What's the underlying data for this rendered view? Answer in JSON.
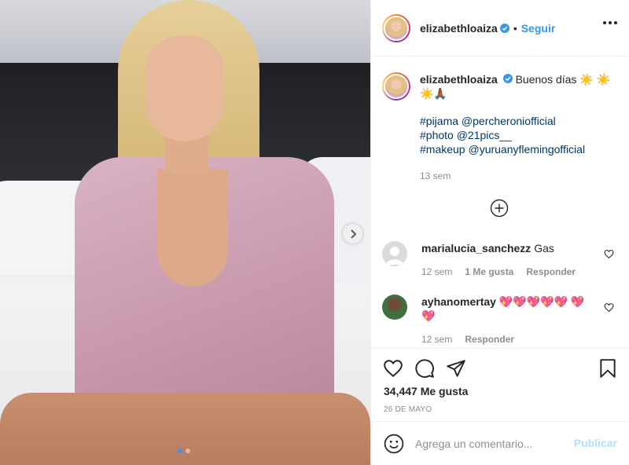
{
  "post": {
    "username": "elizabethloaiza",
    "follow_label": "Seguir",
    "bullet": "•",
    "verified_icon": "verified-badge-icon",
    "more_icon": "more-options-icon"
  },
  "caption": {
    "username": "elizabethloaiza",
    "text": "Buenos días ☀️ ☀️☀️🙏🏾",
    "hashtags": [
      "#pijama @percheroniofficial",
      "#photo @21pics__",
      "#makeup @yuruanyflemingofficial"
    ],
    "time": "13 sem"
  },
  "load_more_icon": "plus-circle-icon",
  "comments": [
    {
      "username": "marialucia_sanchezz",
      "text": "Gas",
      "time": "12 sem",
      "likes": "1 Me gusta",
      "reply": "Responder"
    },
    {
      "username": "ayhanomertay",
      "text": "💖💖💖💖💖 💖💖",
      "time": "12 sem",
      "reply": "Responder"
    }
  ],
  "actions": {
    "icons": [
      "heart-icon",
      "comment-icon",
      "share-icon",
      "save-icon"
    ],
    "likes": "34,447 Me gusta",
    "date": "26 DE MAYO"
  },
  "add_comment": {
    "placeholder": "Agrega un comentario...",
    "publish_label": "Publicar",
    "emoji_icon": "emoji-icon"
  },
  "carousel": {
    "total": 2,
    "current": 1
  },
  "colors": {
    "accent": "#3797f0",
    "link": "#00376b",
    "muted": "#8e8e8e",
    "publish_disabled": "#b2dffc"
  }
}
